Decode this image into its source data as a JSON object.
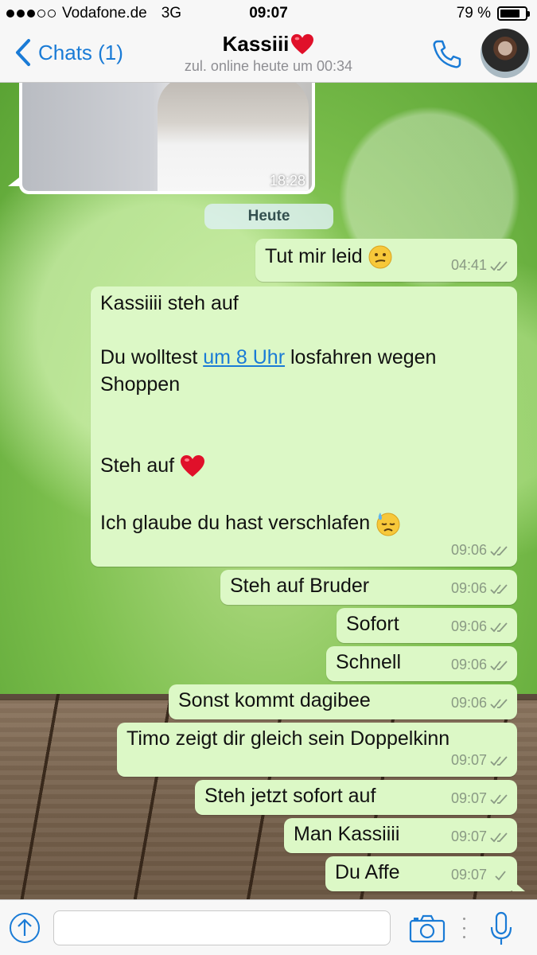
{
  "status_bar": {
    "carrier": "Vodafone.de",
    "network": "3G",
    "time": "09:07",
    "battery": "79 %",
    "battery_level": 0.79,
    "signal_bars_filled": 3,
    "signal_bars_total": 5
  },
  "nav": {
    "back_label": "Chats (1)",
    "contact_name": "Kassiii",
    "last_seen": "zul. online heute um 00:34"
  },
  "colors": {
    "accent": "#1a7bd6",
    "outgoing_bubble": "#dcf8c6",
    "read_receipt": "#8a9a84"
  },
  "chat": {
    "image_message": {
      "time": "18:28"
    },
    "date_separator": "Heute",
    "messages": [
      {
        "text": "Tut mir leid",
        "emoji": "confused-face",
        "time": "04:41"
      },
      {
        "line1": "Kassiiii steh auf",
        "line2_before": "Du wolltest ",
        "line2_link": "um 8 Uhr",
        "line2_after": " losfahren wegen",
        "line3": "Shoppen",
        "line4": "Steh auf",
        "line4_emoji": "red-heart",
        "line5": "Ich glaube du hast verschlafen",
        "line5_emoji": "downcast-face-with-sweat",
        "time": "09:06"
      },
      {
        "text": "Steh auf Bruder",
        "time": "09:06"
      },
      {
        "text": "Sofort",
        "time": "09:06"
      },
      {
        "text": "Schnell",
        "time": "09:06"
      },
      {
        "text": "Sonst kommt dagibee",
        "time": "09:06"
      },
      {
        "text": "Timo zeigt dir gleich sein Doppelkinn",
        "time": "09:07"
      },
      {
        "text": "Steh jetzt sofort auf",
        "time": "09:07"
      },
      {
        "text": "Man Kassiiii",
        "time": "09:07"
      },
      {
        "text": "Du Affe",
        "time": "09:07"
      }
    ]
  },
  "input_bar": {
    "message_value": "",
    "icons": [
      "share-icon",
      "camera-icon",
      "more-icon",
      "microphone-icon"
    ]
  }
}
